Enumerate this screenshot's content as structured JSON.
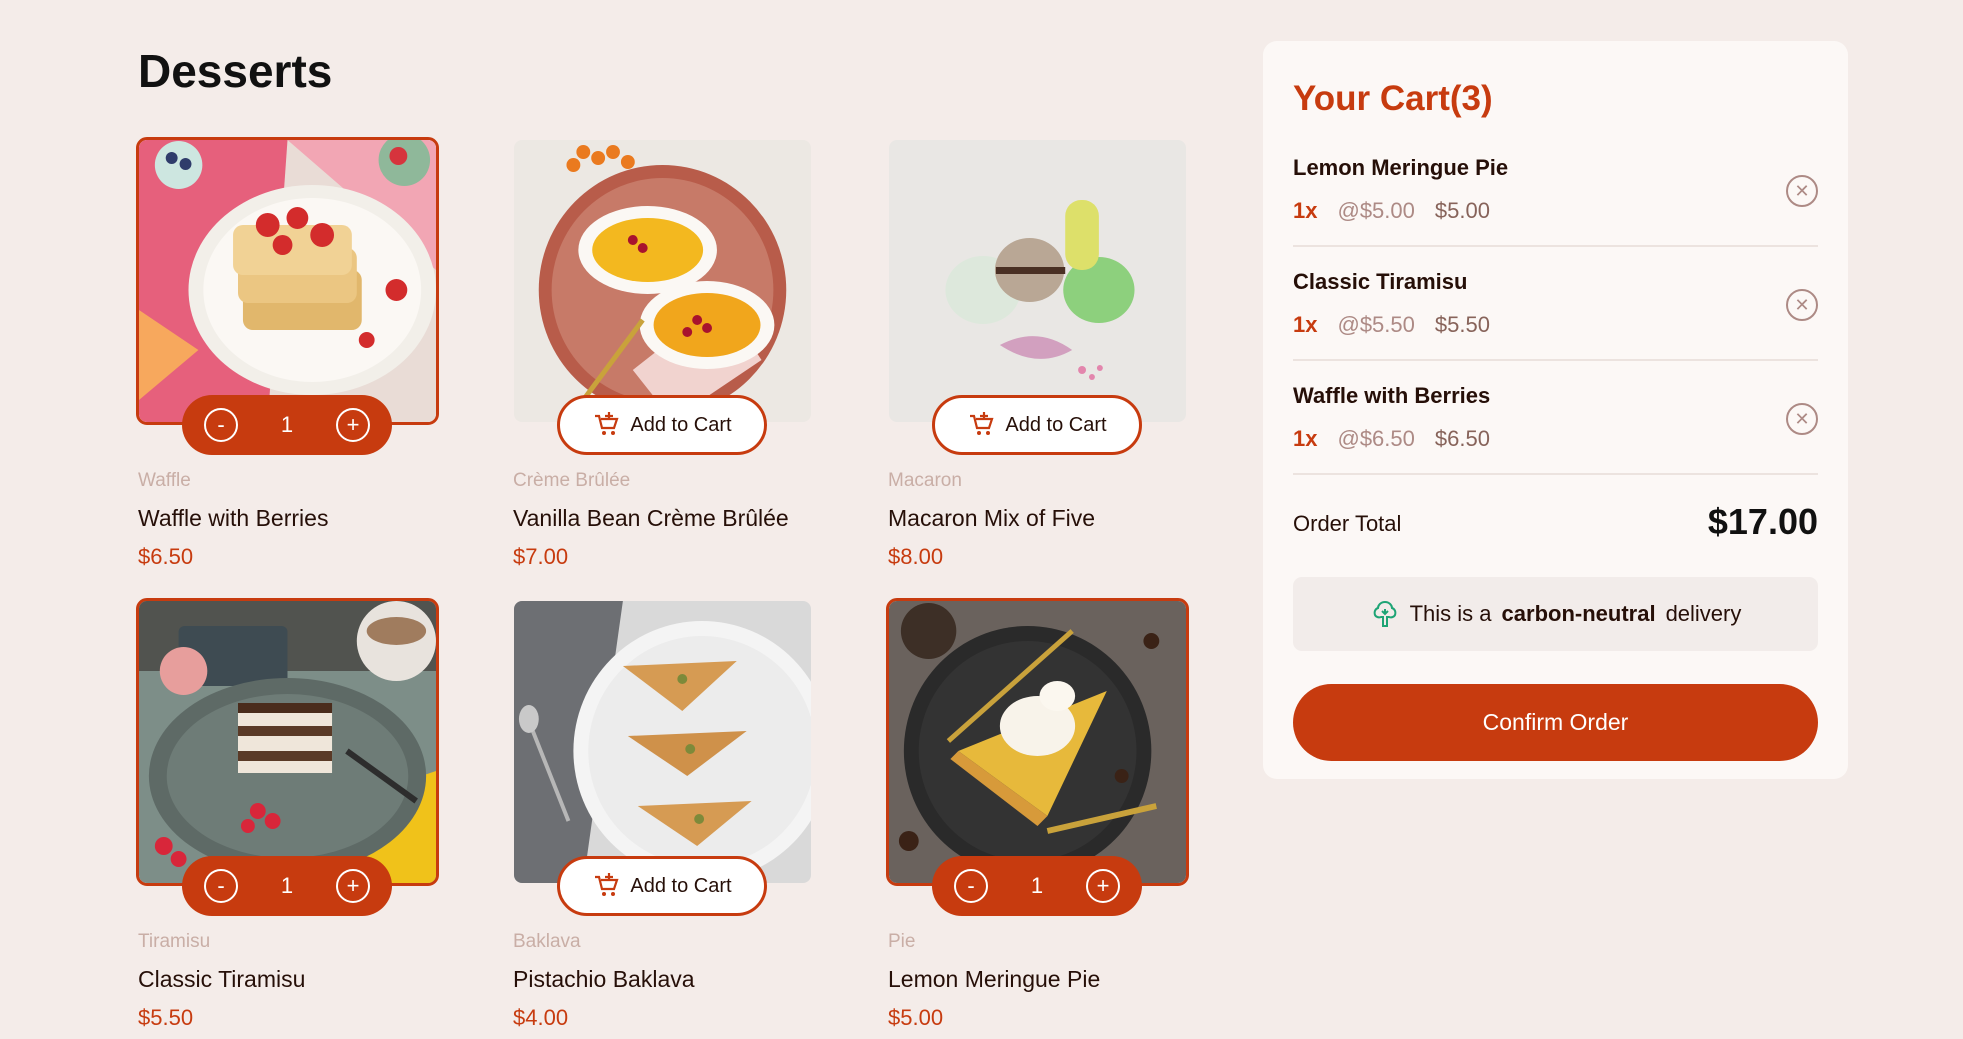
{
  "page_title": "Desserts",
  "products": [
    {
      "category": "Waffle",
      "name": "Waffle with Berries",
      "price": "$6.50",
      "in_cart": true,
      "quantity": "1"
    },
    {
      "category": "Crème Brûlée",
      "name": "Vanilla Bean Crème Brûlée",
      "price": "$7.00",
      "in_cart": false
    },
    {
      "category": "Macaron",
      "name": "Macaron Mix of Five",
      "price": "$8.00",
      "in_cart": false
    },
    {
      "category": "Tiramisu",
      "name": "Classic Tiramisu",
      "price": "$5.50",
      "in_cart": true,
      "quantity": "1"
    },
    {
      "category": "Baklava",
      "name": "Pistachio Baklava",
      "price": "$4.00",
      "in_cart": false
    },
    {
      "category": "Pie",
      "name": "Lemon Meringue Pie",
      "price": "$5.00",
      "in_cart": true,
      "quantity": "1"
    }
  ],
  "buttons": {
    "add_to_cart": "Add to Cart",
    "decrement": "-",
    "increment": "+"
  },
  "cart": {
    "title": "Your Cart",
    "count": "(3)",
    "items": [
      {
        "name": "Lemon Meringue Pie",
        "qty": "1x",
        "unit": "@$5.00",
        "total": "$5.00"
      },
      {
        "name": "Classic Tiramisu",
        "qty": "1x",
        "unit": "@$5.50",
        "total": "$5.50"
      },
      {
        "name": "Waffle with Berries",
        "qty": "1x",
        "unit": "@$6.50",
        "total": "$6.50"
      }
    ],
    "order_total_label": "Order Total",
    "order_total_value": "$17.00",
    "carbon_prefix": "This is a",
    "carbon_bold": "carbon-neutral",
    "carbon_suffix": "delivery",
    "confirm_label": "Confirm Order"
  },
  "colors": {
    "accent": "#c73b0f",
    "background": "#f4ece9",
    "card": "#fcf8f6",
    "carbon_icon": "#1ea475"
  }
}
